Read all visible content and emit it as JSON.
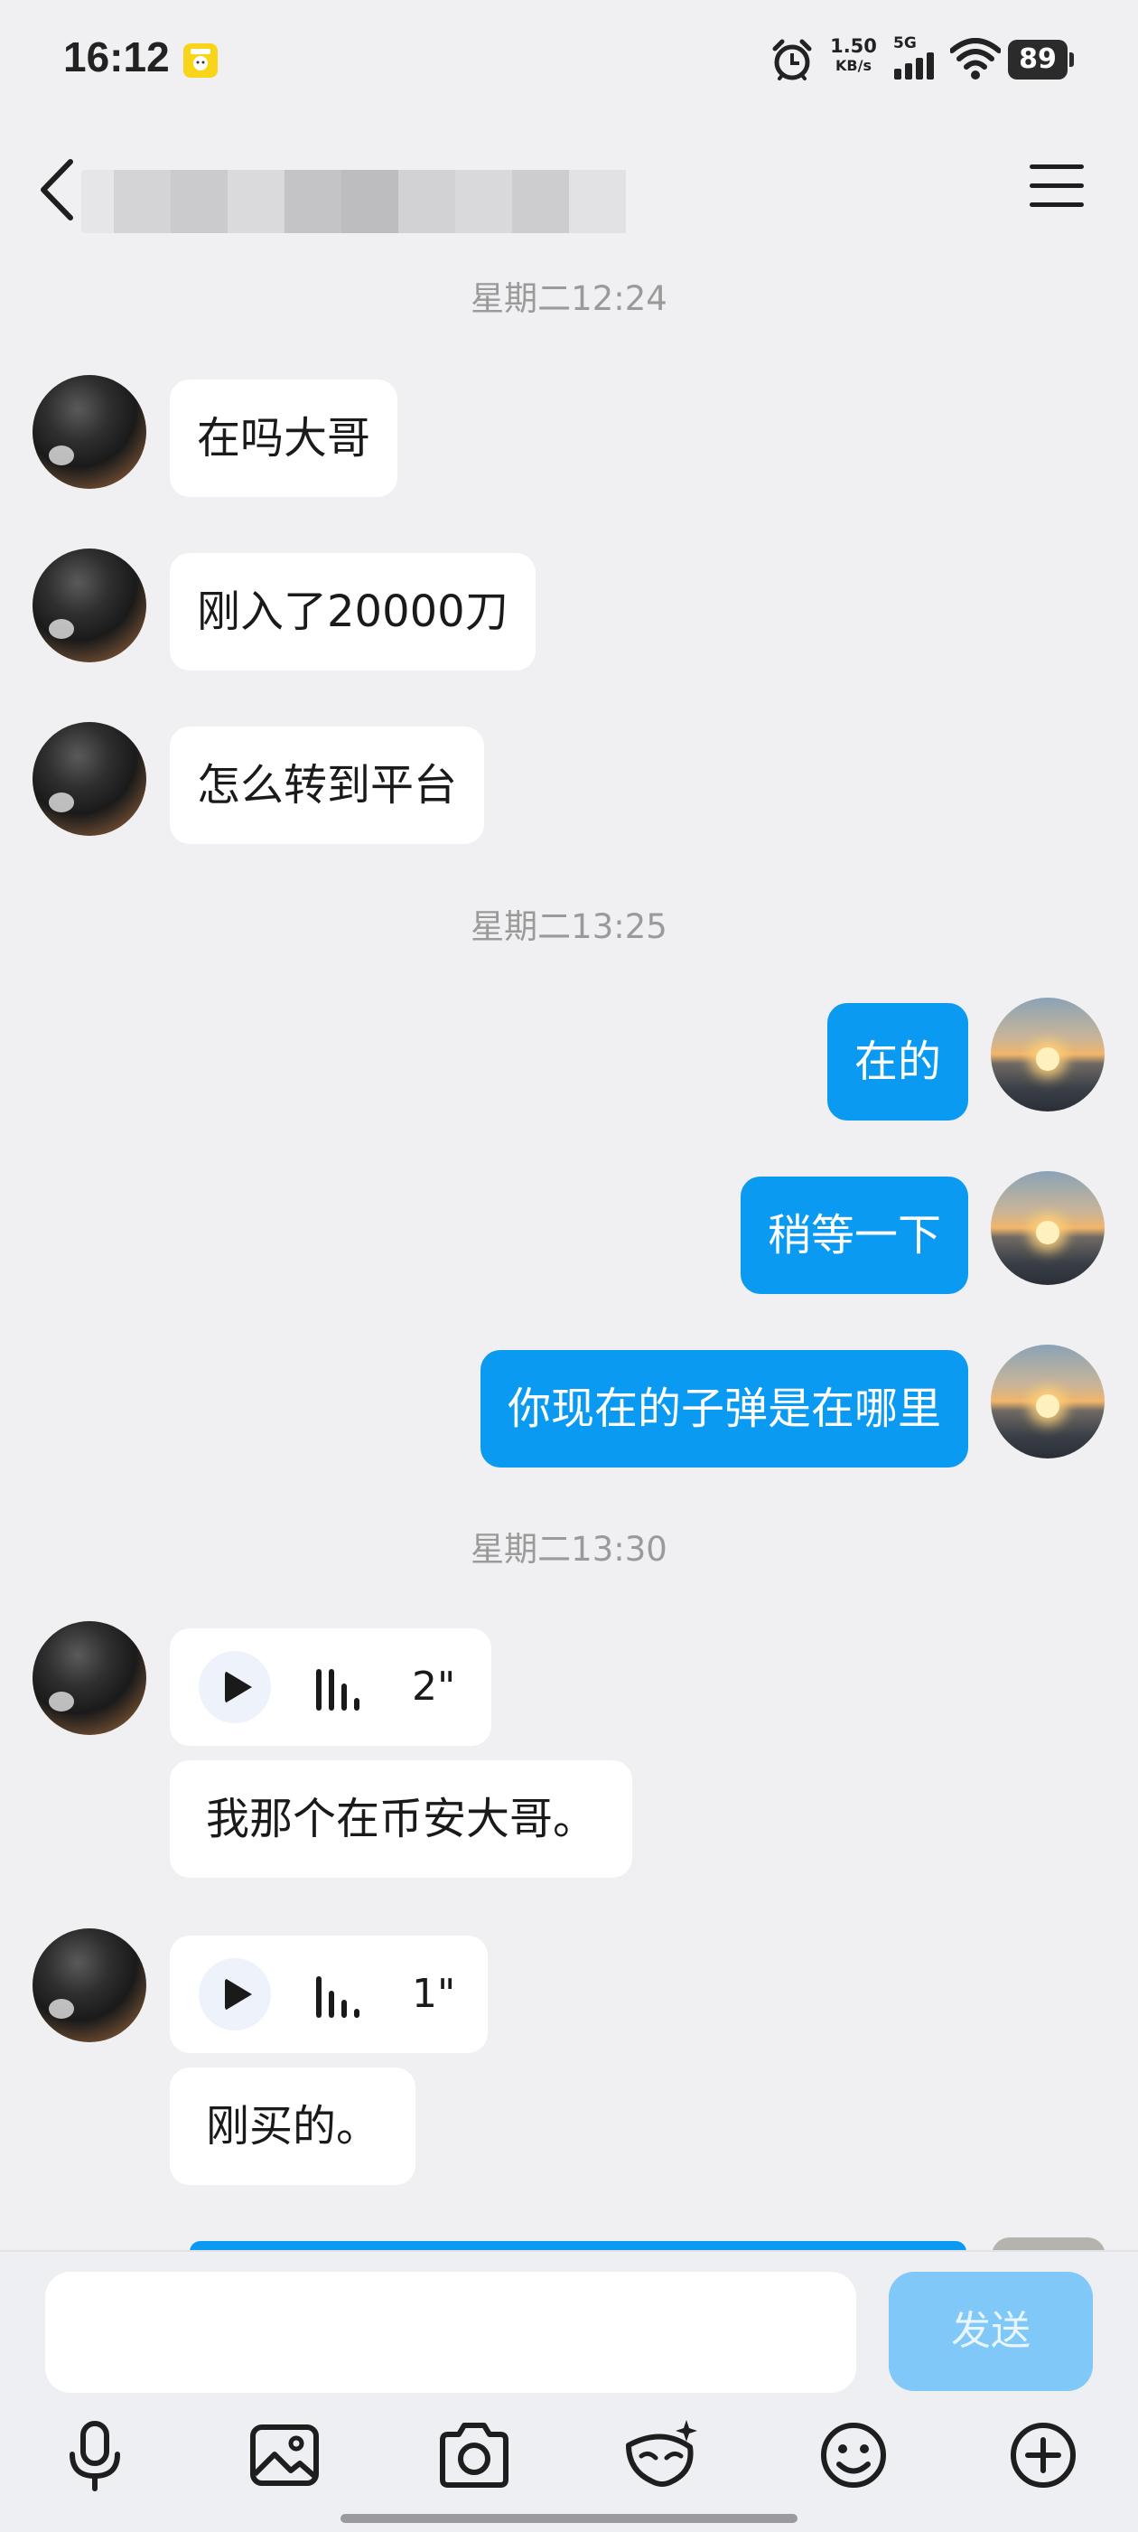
{
  "status_bar": {
    "time": "16:12",
    "net_speed_value": "1.50",
    "net_speed_unit": "KB/s",
    "network_type": "5G",
    "battery": "89"
  },
  "header": {
    "back_icon": "chevron-left-icon",
    "menu_icon": "hamburger-menu-icon"
  },
  "messages": {
    "timestamp_1": "星期二12:24",
    "friend_msg_1": "在吗大哥",
    "friend_msg_2": "刚入了20000刀",
    "friend_msg_3": "怎么转到平台",
    "timestamp_2": "星期二13:25",
    "self_msg_1": "在的",
    "self_msg_2": "稍等一下",
    "self_msg_3": "你现在的子弹是在哪里",
    "timestamp_3": "星期二13:30",
    "voice_1_duration": "2\"",
    "friend_msg_4": "我那个在币安大哥。",
    "voice_2_duration": "1\"",
    "friend_msg_5": "刚买的。"
  },
  "input_bar": {
    "placeholder": "",
    "send_label": "发送",
    "tools": [
      "microphone-icon",
      "image-icon",
      "camera-icon",
      "mask-effect-icon",
      "emoji-icon",
      "plus-icon"
    ]
  },
  "colors": {
    "background": "#f0f0f3",
    "outgoing_bubble": "#0a9af2",
    "incoming_bubble": "#ffffff",
    "send_button_disabled": "#7fc8f8"
  }
}
